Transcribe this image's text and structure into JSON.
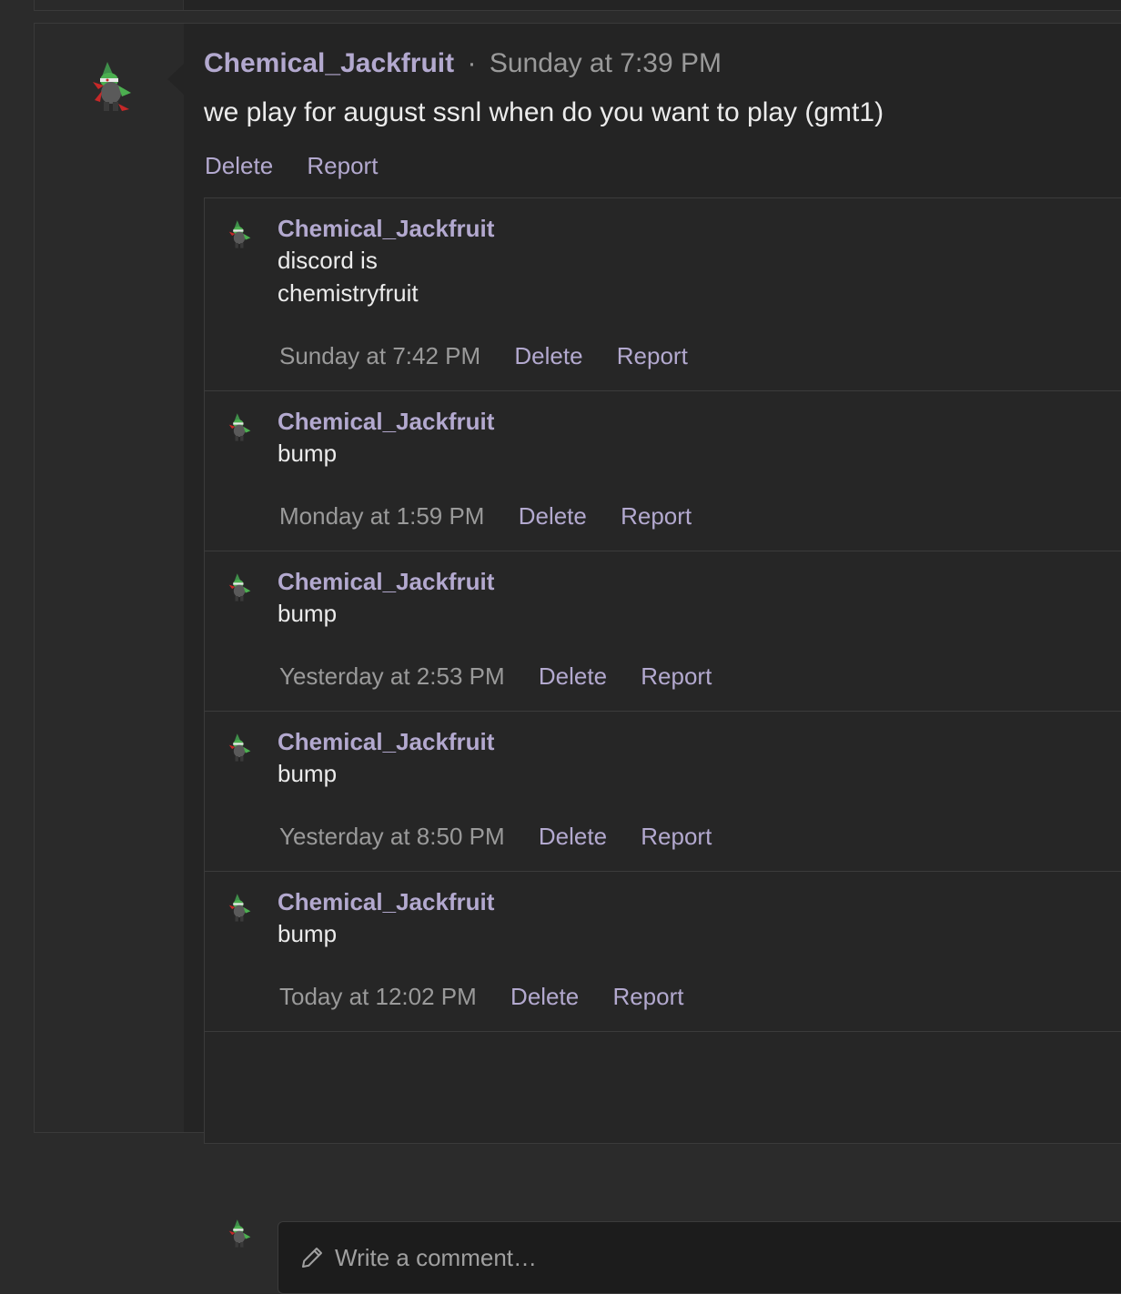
{
  "post": {
    "author": "Chemical_Jackfruit",
    "separator": "·",
    "time": "Sunday at 7:39 PM",
    "text": "we play for august ssnl when do you want to play (gmt1)",
    "actions": {
      "delete": "Delete",
      "report": "Report"
    }
  },
  "comments": [
    {
      "author": "Chemical_Jackfruit",
      "lines": [
        "discord is",
        "chemistryfruit"
      ],
      "time": "Sunday at 7:42 PM",
      "delete": "Delete",
      "report": "Report"
    },
    {
      "author": "Chemical_Jackfruit",
      "lines": [
        "bump"
      ],
      "time": "Monday at 1:59 PM",
      "delete": "Delete",
      "report": "Report"
    },
    {
      "author": "Chemical_Jackfruit",
      "lines": [
        "bump"
      ],
      "time": "Yesterday at 2:53 PM",
      "delete": "Delete",
      "report": "Report"
    },
    {
      "author": "Chemical_Jackfruit",
      "lines": [
        "bump"
      ],
      "time": "Yesterday at 8:50 PM",
      "delete": "Delete",
      "report": "Report"
    },
    {
      "author": "Chemical_Jackfruit",
      "lines": [
        "bump"
      ],
      "time": "Today at 12:02 PM",
      "delete": "Delete",
      "report": "Report"
    }
  ],
  "composer": {
    "icon": "pencil-icon",
    "placeholder": "Write a comment…"
  },
  "colors": {
    "accent": "#b3a9cf",
    "muted": "#9a9a9a",
    "text": "#ececec",
    "background": "#242424"
  }
}
